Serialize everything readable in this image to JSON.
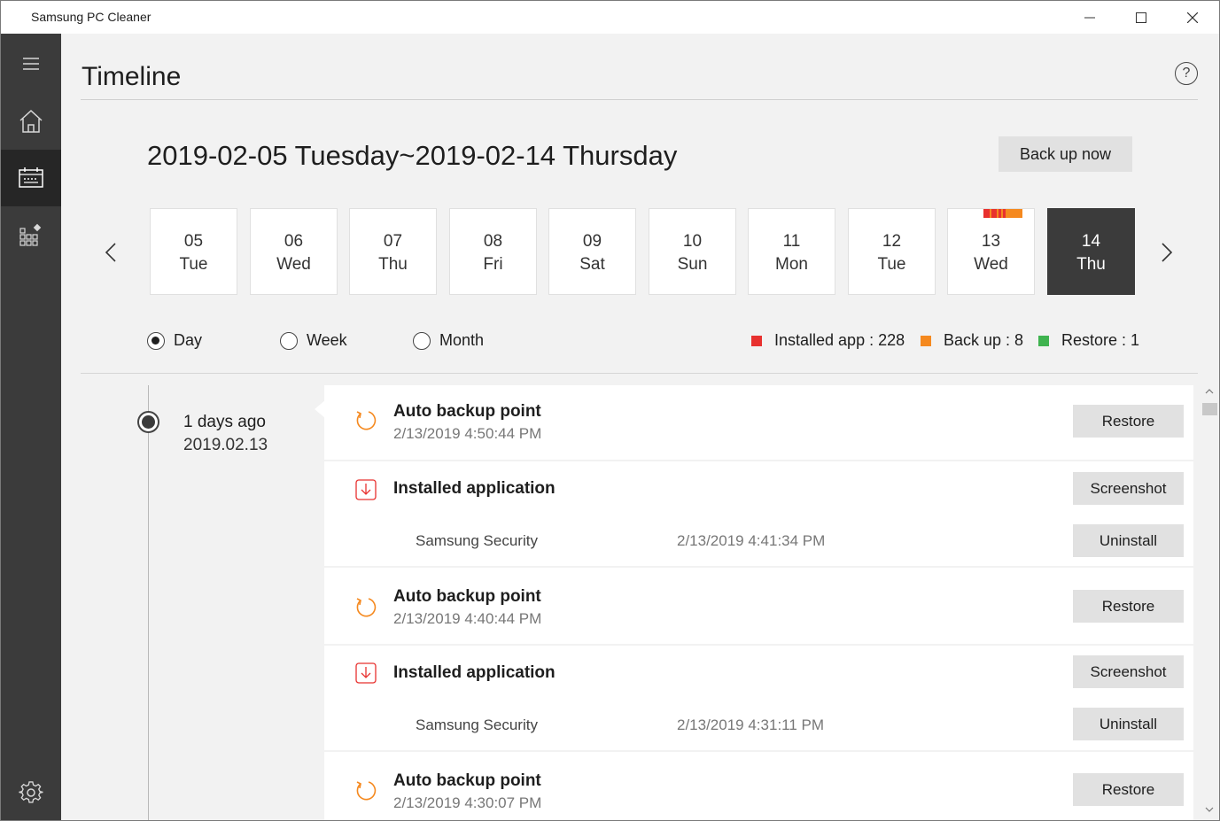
{
  "window": {
    "title": "Samsung PC Cleaner",
    "minimize_icon": "minimize-icon",
    "maximize_icon": "maximize-icon",
    "close_icon": "close-icon"
  },
  "sidebar": {
    "items": [
      {
        "name": "menu",
        "icon": "hamburger-icon"
      },
      {
        "name": "home",
        "icon": "home-icon"
      },
      {
        "name": "timeline",
        "icon": "calendar-icon",
        "active": true
      },
      {
        "name": "apps",
        "icon": "apps-grid-icon"
      },
      {
        "name": "settings",
        "icon": "gear-icon"
      }
    ]
  },
  "header": {
    "title": "Timeline",
    "help_label": "?"
  },
  "range": {
    "title": "2019-02-05 Tuesday~2019-02-14 Thursday",
    "backup_label": "Back up now"
  },
  "days": [
    {
      "num": "05",
      "dow": "Tue"
    },
    {
      "num": "06",
      "dow": "Wed"
    },
    {
      "num": "07",
      "dow": "Thu"
    },
    {
      "num": "08",
      "dow": "Fri"
    },
    {
      "num": "09",
      "dow": "Sat"
    },
    {
      "num": "10",
      "dow": "Sun"
    },
    {
      "num": "11",
      "dow": "Mon"
    },
    {
      "num": "12",
      "dow": "Tue"
    },
    {
      "num": "13",
      "dow": "Wed"
    },
    {
      "num": "14",
      "dow": "Thu",
      "selected": true
    }
  ],
  "view_modes": [
    {
      "label": "Day",
      "checked": true
    },
    {
      "label": "Week",
      "checked": false
    },
    {
      "label": "Month",
      "checked": false
    }
  ],
  "legend": [
    {
      "label": "Installed app : 228",
      "color": "#e8312f"
    },
    {
      "label": "Back up : 8",
      "color": "#f5891f"
    },
    {
      "label": "Restore : 1",
      "color": "#3fb34f"
    }
  ],
  "timeline": {
    "ago": "1 days ago",
    "date": "2019.02.13",
    "entries": [
      {
        "type": "backup",
        "title": "Auto backup point",
        "time": "2/13/2019 4:50:44 PM",
        "action": "Restore"
      },
      {
        "type": "install",
        "title": "Installed application",
        "action": "Screenshot",
        "app": "Samsung Security",
        "app_time": "2/13/2019 4:41:34 PM",
        "app_action": "Uninstall"
      },
      {
        "type": "backup",
        "title": "Auto backup point",
        "time": "2/13/2019 4:40:44 PM",
        "action": "Restore"
      },
      {
        "type": "install",
        "title": "Installed application",
        "action": "Screenshot",
        "app": "Samsung Security",
        "app_time": "2/13/2019 4:31:11 PM",
        "app_action": "Uninstall"
      },
      {
        "type": "backup",
        "title": "Auto backup point",
        "time": "2/13/2019 4:30:07 PM",
        "action": "Restore"
      }
    ]
  }
}
